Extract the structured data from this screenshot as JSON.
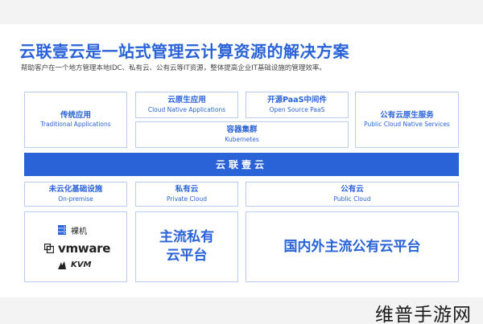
{
  "title": "云联壹云是一站式管理云计算资源的解决方案",
  "subtitle": "帮助客户在一个地方管理本地IDC、私有云、公有云等IT资源，整体提高企业IT基础设施的管理效率。",
  "apps": {
    "traditional": {
      "zh": "传统应用",
      "en": "Traditional Applications"
    },
    "cloud_native": {
      "zh": "云原生应用",
      "en": "Cloud Native Applications"
    },
    "open_source": {
      "zh": "开源PaaS中间件",
      "en": "Open Source PaaS"
    },
    "public_native": {
      "zh": "公有云原生服务",
      "en": "Public Cloud Native Services"
    },
    "kubernetes": {
      "zh": "容器集群",
      "en": "Kubernetes"
    }
  },
  "platform_bar": "云联壹云",
  "infra": {
    "on_premise": {
      "zh": "未云化基础设施",
      "en": "On-premise"
    },
    "private": {
      "zh": "私有云",
      "en": "Private Cloud"
    },
    "public": {
      "zh": "公有云",
      "en": "Public Cloud"
    }
  },
  "on_premise_vendors": {
    "bare_metal": "裸机",
    "vmware": "vmware",
    "kvm": "KVM"
  },
  "private_big": [
    "主流私有",
    "云平台"
  ],
  "public_big": "国内外主流公有云平台",
  "watermark": "维普手游网",
  "colors": {
    "accent": "#2a63d8",
    "border": "#b9cdf0"
  }
}
